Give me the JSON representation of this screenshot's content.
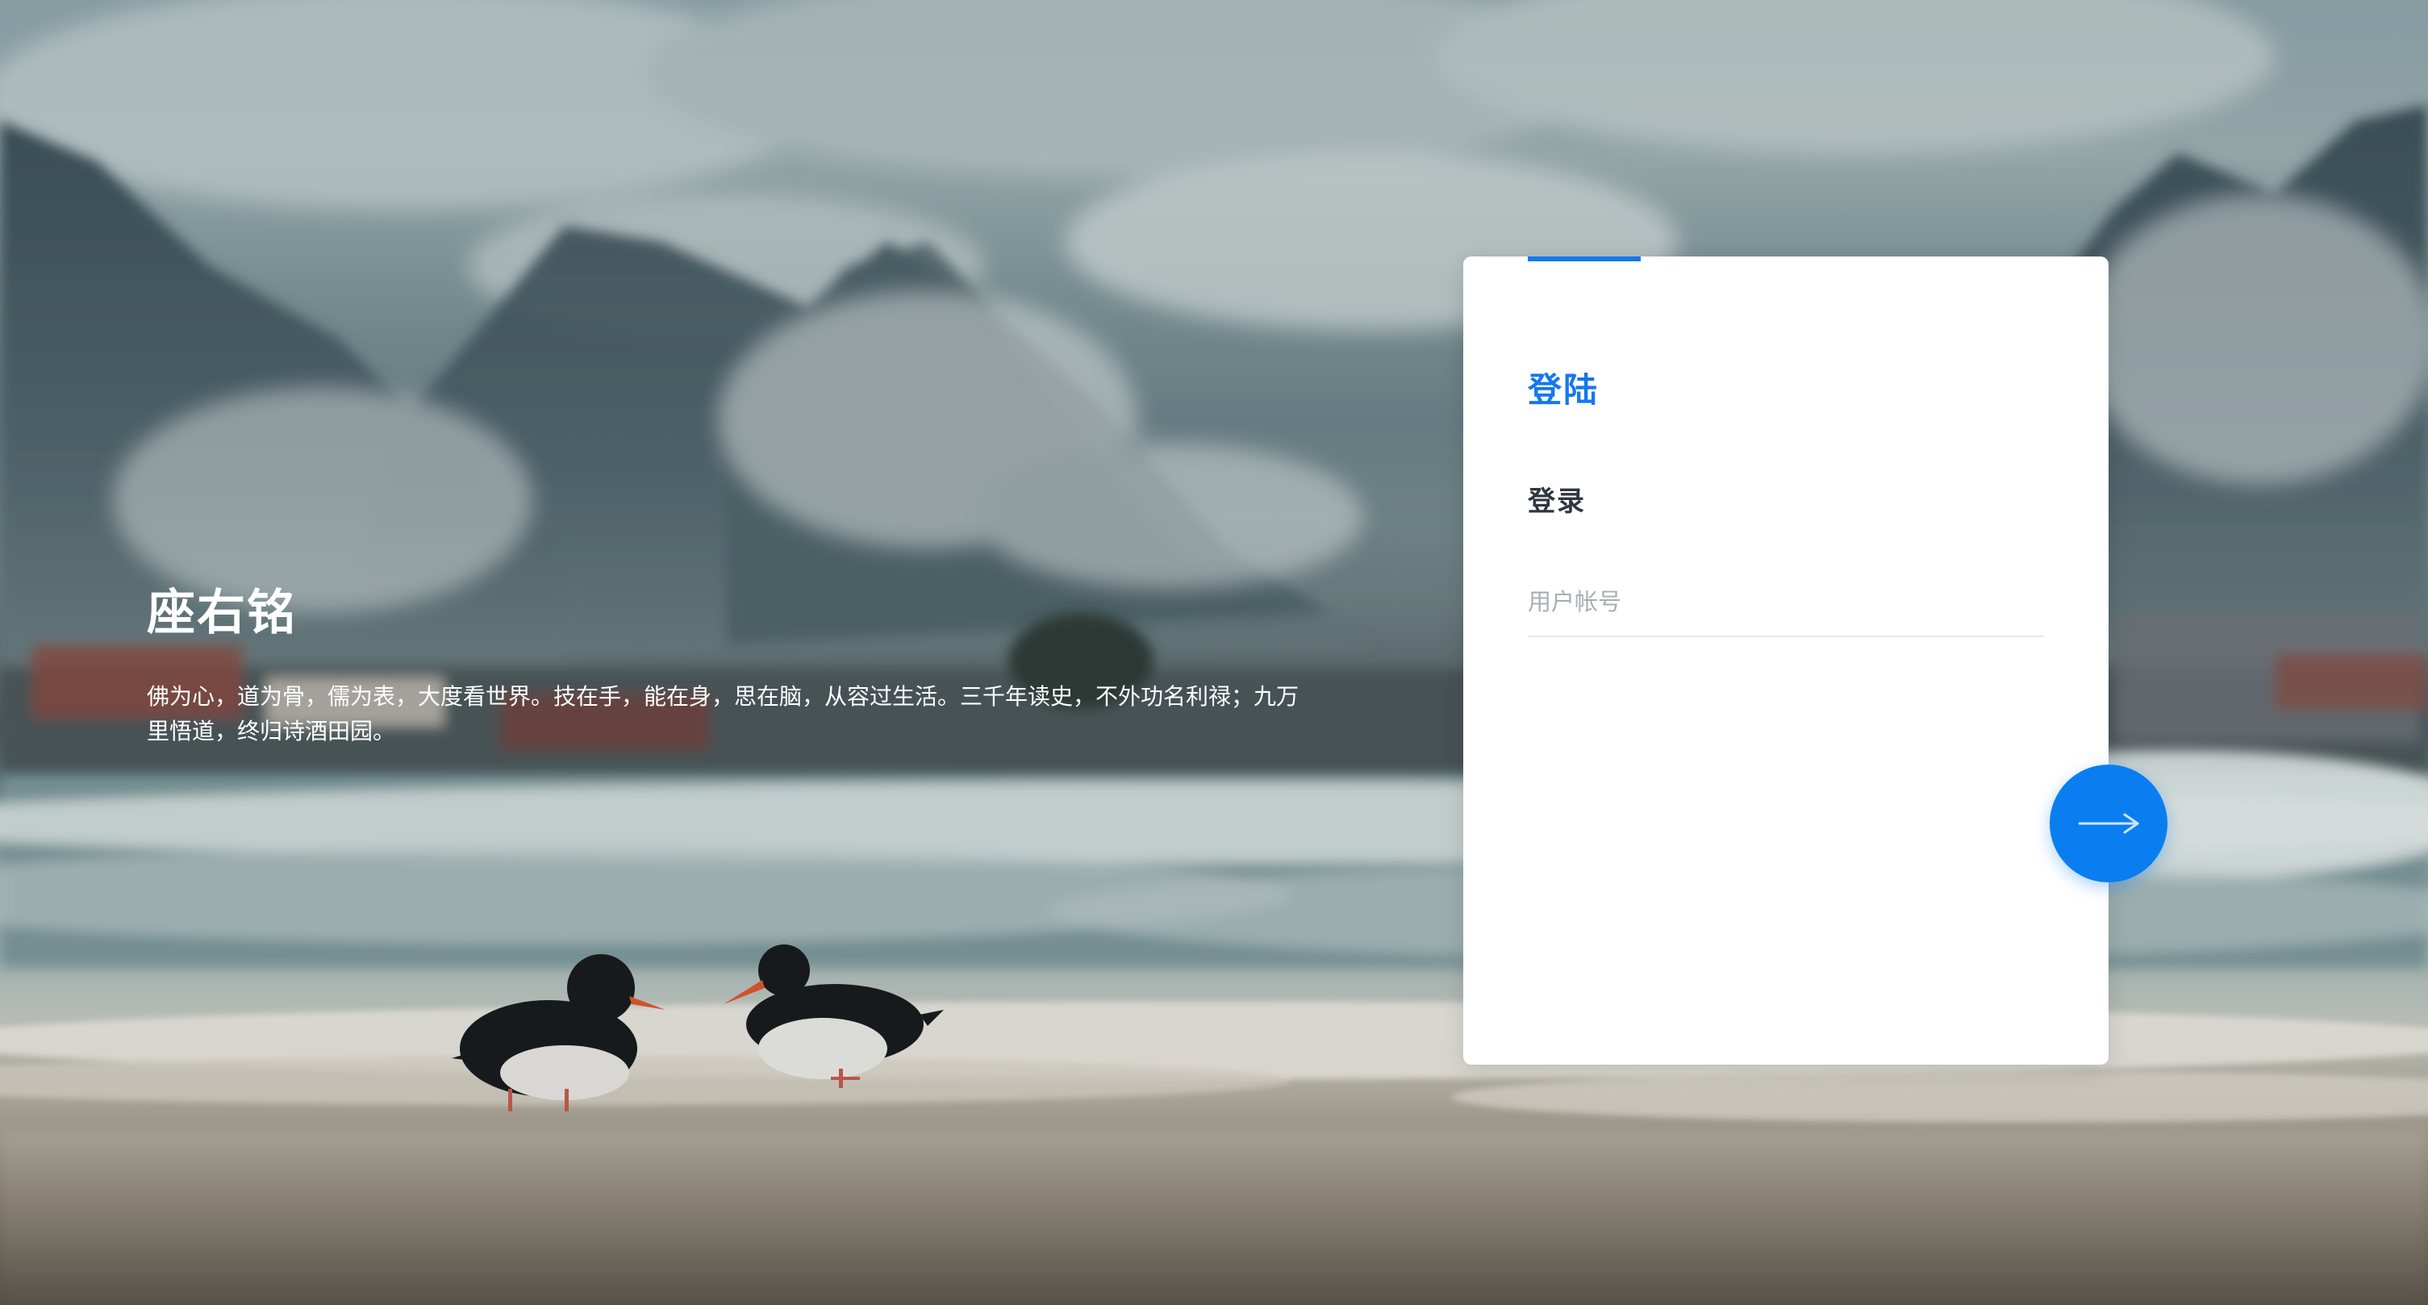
{
  "motto": {
    "title": "座右铭",
    "text": "佛为心，道为骨，儒为表，大度看世界。技在手，能在身，思在脑，从容过生活。三千年读史，不外功名利禄；九万里悟道，终归诗酒田园。"
  },
  "login": {
    "heading": "登陆",
    "subheading": "登录",
    "username_placeholder": "用户帐号",
    "username_value": ""
  },
  "submit": {
    "icon": "arrow-right-icon"
  },
  "colors": {
    "accent": "#1677ee",
    "button": "#0a7ef0",
    "card": "#ffffff",
    "text_dark": "#303640",
    "placeholder": "#a9adb3"
  }
}
